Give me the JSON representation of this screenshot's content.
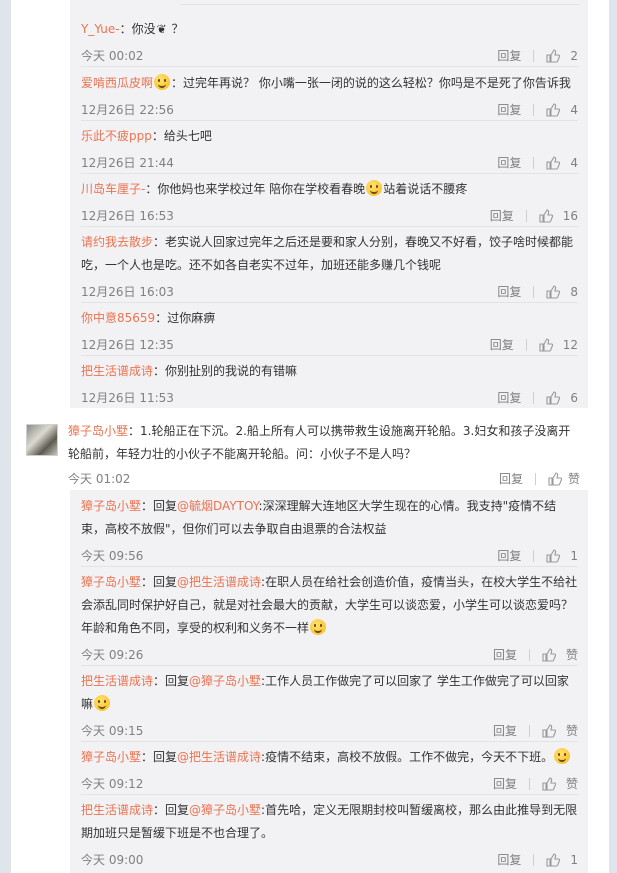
{
  "labels": {
    "reply": "回复",
    "like": "赞"
  },
  "top_replies": [
    {
      "nick": "Y_Yue-",
      "sep": "：",
      "pre": "你没",
      "post": "？",
      "time": "今天 00:02",
      "likes": "2"
    },
    {
      "nick": "爱啃西瓜皮啊",
      "sep": "：",
      "pre": "过完年再说？ 你小嘴一张一闭的说的这么轻松？你吗是不是死了你告诉我",
      "time": "12月26日 22:56",
      "likes": "4"
    },
    {
      "nick": "乐此不疲ppp",
      "sep": "：",
      "pre": "给头七吧",
      "time": "12月26日 21:44",
      "likes": "4"
    },
    {
      "nick": "川岛车厘子-",
      "sep": "：",
      "pre": "你他妈也来学校过年 陪你在学校看春晚",
      "post": "站着说话不腰疼",
      "time": "12月26日 16:53",
      "likes": "16"
    },
    {
      "nick": "请约我去散步",
      "sep": "：",
      "pre": "老实说人回家过完年之后还是要和家人分别，春晚又不好看，饺子啥时候都能吃，一个人也是吃。还不如各自老实不过年，加班还能多赚几个钱呢",
      "time": "12月26日 16:03",
      "likes": "8"
    },
    {
      "nick": "你中意85659",
      "sep": "：",
      "pre": "过你麻痹",
      "time": "12月26日 12:35",
      "likes": "12"
    },
    {
      "nick": "把生活谱成诗",
      "sep": "：",
      "pre": "你别扯别的我说的有错嘛",
      "time": "12月26日 11:53",
      "likes": "6"
    }
  ],
  "main_comment": {
    "nick": "獐子岛小墅",
    "text": "：1.轮船正在下沉。2.船上所有人可以携带救生设施离开轮船。3.妇女和孩子没离开轮船前，年轻力壮的小伙子不能离开轮船。问：小伙子不是人吗？",
    "time": "今天 01:02"
  },
  "bottom_replies": [
    {
      "nick": "獐子岛小墅",
      "mid": "：回复",
      "at": "@毓烟DAYTOY",
      "pre": ":深深理解大连地区大学生现在的心情。我支持\"疫情不结束，高校不放假\"，但你们可以去争取自由退票的合法权益",
      "time": "今天 09:56",
      "likes": "1"
    },
    {
      "nick": "獐子岛小墅",
      "mid": "：回复",
      "at": "@把生活谱成诗",
      "pre": ":在职人员在给社会创造价值，疫情当头，在校大学生不给社会添乱同时保护好自己，就是对社会最大的贡献，大学生可以谈恋爱，小学生可以谈恋爱吗？年龄和角色不同，享受的权利和义务不一样",
      "time": "今天 09:26",
      "likes": "赞"
    },
    {
      "nick": "把生活谱成诗",
      "mid": "：回复",
      "at": "@獐子岛小墅",
      "pre": ":工作人员工作做完了可以回家了 学生工作做完了可以回家嘛",
      "time": "今天 09:15",
      "likes": "赞"
    },
    {
      "nick": "獐子岛小墅",
      "mid": "：回复",
      "at": "@把生活谱成诗",
      "pre": ":疫情不结束，高校不放假。工作不做完，今天不下班。",
      "time": "今天 09:12",
      "likes": "赞"
    },
    {
      "nick": "把生活谱成诗",
      "mid": "：回复",
      "at": "@獐子岛小墅",
      "pre": ":首先哈，定义无限期封校叫暂缓离校，那么由此推导到无限期加班只是暂缓下班是不也合理了。",
      "time": "今天 09:00",
      "likes": "1"
    }
  ]
}
